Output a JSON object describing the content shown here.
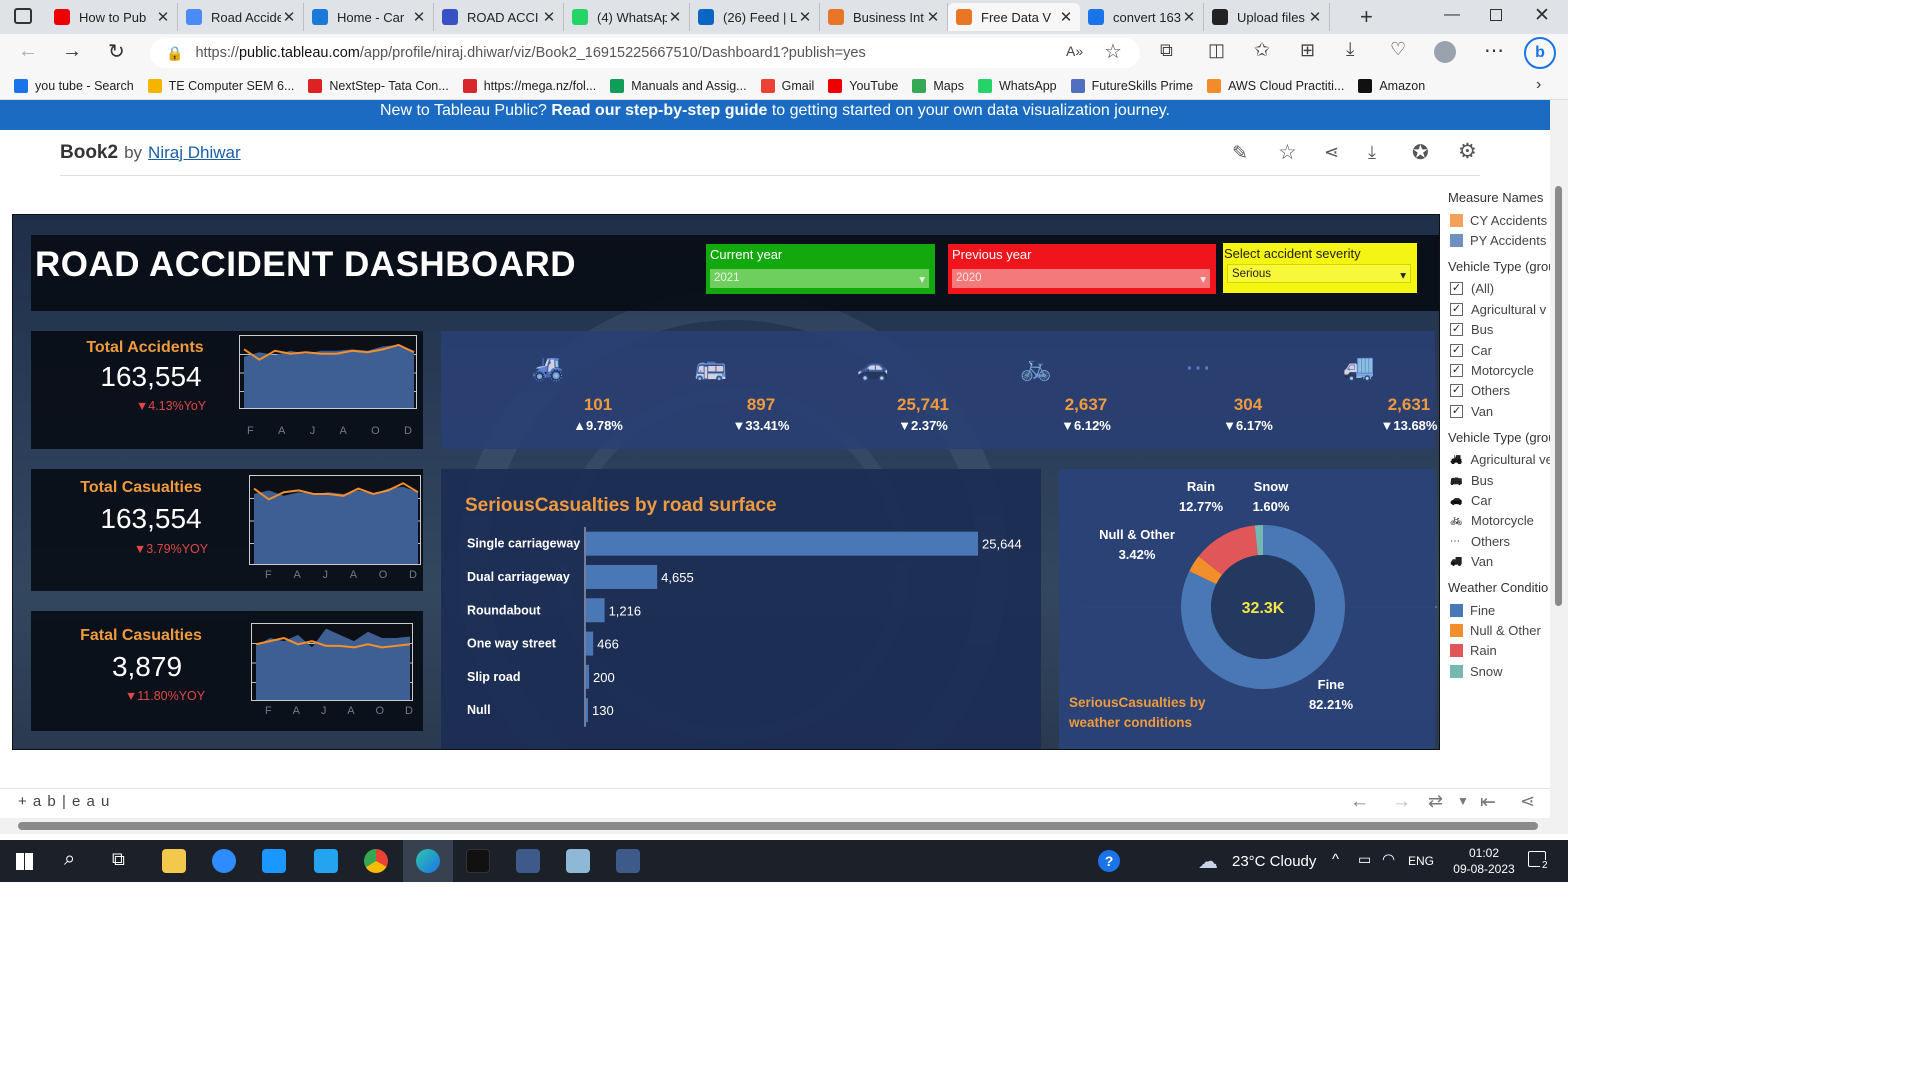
{
  "browser": {
    "tabs": [
      {
        "title": "How to Pub",
        "color": "#e00"
      },
      {
        "title": "Road Accide",
        "color": "#4b8bf5"
      },
      {
        "title": "Home - Car",
        "color": "#1b7ad8"
      },
      {
        "title": "ROAD ACCI",
        "color": "#3a51c4"
      },
      {
        "title": "(4) WhatsAp",
        "color": "#25d366"
      },
      {
        "title": "(26) Feed | L",
        "color": "#0a66c2"
      },
      {
        "title": "Business Int",
        "color": "#e97627"
      },
      {
        "title": "Free Data V",
        "color": "#e97627"
      },
      {
        "title": "convert 163",
        "color": "#1a73e8"
      },
      {
        "title": "Upload files",
        "color": "#222"
      }
    ],
    "url_prefix": "https://",
    "url_host": "public.tableau.com",
    "url_path": "/app/profile/niraj.dhiwar/viz/Book2_16915225667510/Dashboard1?publish=yes",
    "bookmarks": [
      {
        "label": "you tube - Search",
        "color": "#1a73e8"
      },
      {
        "label": "TE Computer SEM 6...",
        "color": "#f4b400"
      },
      {
        "label": "NextStep- Tata Con...",
        "color": "#d22"
      },
      {
        "label": "https://mega.nz/fol...",
        "color": "#d9272e"
      },
      {
        "label": "Manuals and Assig...",
        "color": "#0f9d58"
      },
      {
        "label": "Gmail",
        "color": "#ea4335"
      },
      {
        "label": "YouTube",
        "color": "#e00"
      },
      {
        "label": "Maps",
        "color": "#34a853"
      },
      {
        "label": "WhatsApp",
        "color": "#25d366"
      },
      {
        "label": "FutureSkills Prime",
        "color": "#4f6fbf"
      },
      {
        "label": "AWS Cloud Practiti...",
        "color": "#f28c28"
      },
      {
        "label": "Amazon",
        "color": "#111"
      }
    ]
  },
  "tableau": {
    "banner_pre": "New to Tableau Public? ",
    "banner_bold": "Read our step-by-step guide",
    "banner_post": " to getting started on your own data visualization journey.",
    "workbook": "Book2",
    "by": "by",
    "author": "Niraj Dhiwar",
    "footer_logo": "+ a b | e a u"
  },
  "dashboard": {
    "title": "ROAD ACCIDENT DASHBOARD",
    "filters": {
      "current_year_label": "Current year",
      "current_year_value": "2021",
      "previous_year_label": "Previous year",
      "previous_year_value": "2020",
      "severity_label": "Select accident severity",
      "severity_value": "Serious"
    },
    "kpis": [
      {
        "title": "Total Accidents",
        "value": "163,554",
        "yoy": "▼4.13%YoY"
      },
      {
        "title": "Total Casualties",
        "value": "163,554",
        "yoy": "▼3.79%YOY"
      },
      {
        "title": "Fatal  Casualties",
        "value": "3,879",
        "yoy": "▼11.80%YOY"
      }
    ],
    "month_ticks": [
      "F",
      "A",
      "J",
      "A",
      "O",
      "D"
    ],
    "vehicle_types": [
      {
        "icon": "tractor-icon",
        "value": "101",
        "change": "▲9.78%"
      },
      {
        "icon": "bus-icon",
        "value": "897",
        "change": "▼33.41%"
      },
      {
        "icon": "car-icon",
        "value": "25,741",
        "change": "▼2.37%"
      },
      {
        "icon": "motorcycle-icon",
        "value": "2,637",
        "change": "▼6.12%"
      },
      {
        "icon": "others-icon",
        "value": "304",
        "change": "▼6.17%"
      },
      {
        "icon": "van-icon",
        "value": "2,631",
        "change": "▼13.68%"
      }
    ],
    "road_surface": {
      "title": "SeriousCasualties by road surface",
      "rows": [
        {
          "label": "Single carriageway",
          "value": 25644,
          "display": "25,644"
        },
        {
          "label": "Dual carriageway",
          "value": 4655,
          "display": "4,655"
        },
        {
          "label": "Roundabout",
          "value": 1216,
          "display": "1,216"
        },
        {
          "label": "One way street",
          "value": 466,
          "display": "466"
        },
        {
          "label": "Slip road",
          "value": 200,
          "display": "200"
        },
        {
          "label": "Null",
          "value": 130,
          "display": "130"
        }
      ]
    },
    "weather": {
      "title_line1": "SeriousCasualties by",
      "title_line2": "weather conditions",
      "center": "32.3K",
      "slices": [
        {
          "name": "Fine",
          "pct": "82.21%",
          "value": 82.21,
          "color": "#4a78b6"
        },
        {
          "name": "Null & Other",
          "pct": "3.42%",
          "value": 3.42,
          "color": "#f28e2b"
        },
        {
          "name": "Rain",
          "pct": "12.77%",
          "value": 12.77,
          "color": "#e15759"
        },
        {
          "name": "Snow",
          "pct": "1.60%",
          "value": 1.6,
          "color": "#76b7b2"
        }
      ]
    }
  },
  "legend": {
    "measure_header": "Measure Names",
    "measures": [
      {
        "label": "CY Accidents",
        "color": "#f5a05a"
      },
      {
        "label": "PY Accidents",
        "color": "#6f8fc0"
      }
    ],
    "vehicle_filter_header": "Vehicle Type (grou",
    "vehicle_filter_items": [
      "(All)",
      "Agricultural v",
      "Bus",
      "Car",
      "Motorcycle",
      "Others",
      "Van"
    ],
    "vehicle_icon_header": "Vehicle Type (grou",
    "vehicle_icon_items": [
      "Agricultural ve",
      "Bus",
      "Car",
      "Motorcycle",
      "Others",
      "Van"
    ],
    "weather_header": "Weather Conditio",
    "weather_items": [
      {
        "label": "Fine",
        "color": "#4a78b6"
      },
      {
        "label": "Null & Other",
        "color": "#f28e2b"
      },
      {
        "label": "Rain",
        "color": "#e15759"
      },
      {
        "label": "Snow",
        "color": "#76b7b2"
      }
    ]
  },
  "taskbar": {
    "weather": "23°C  Cloudy",
    "lang": "ENG",
    "time": "01:02",
    "date": "09-08-2023",
    "notif": "2"
  }
}
